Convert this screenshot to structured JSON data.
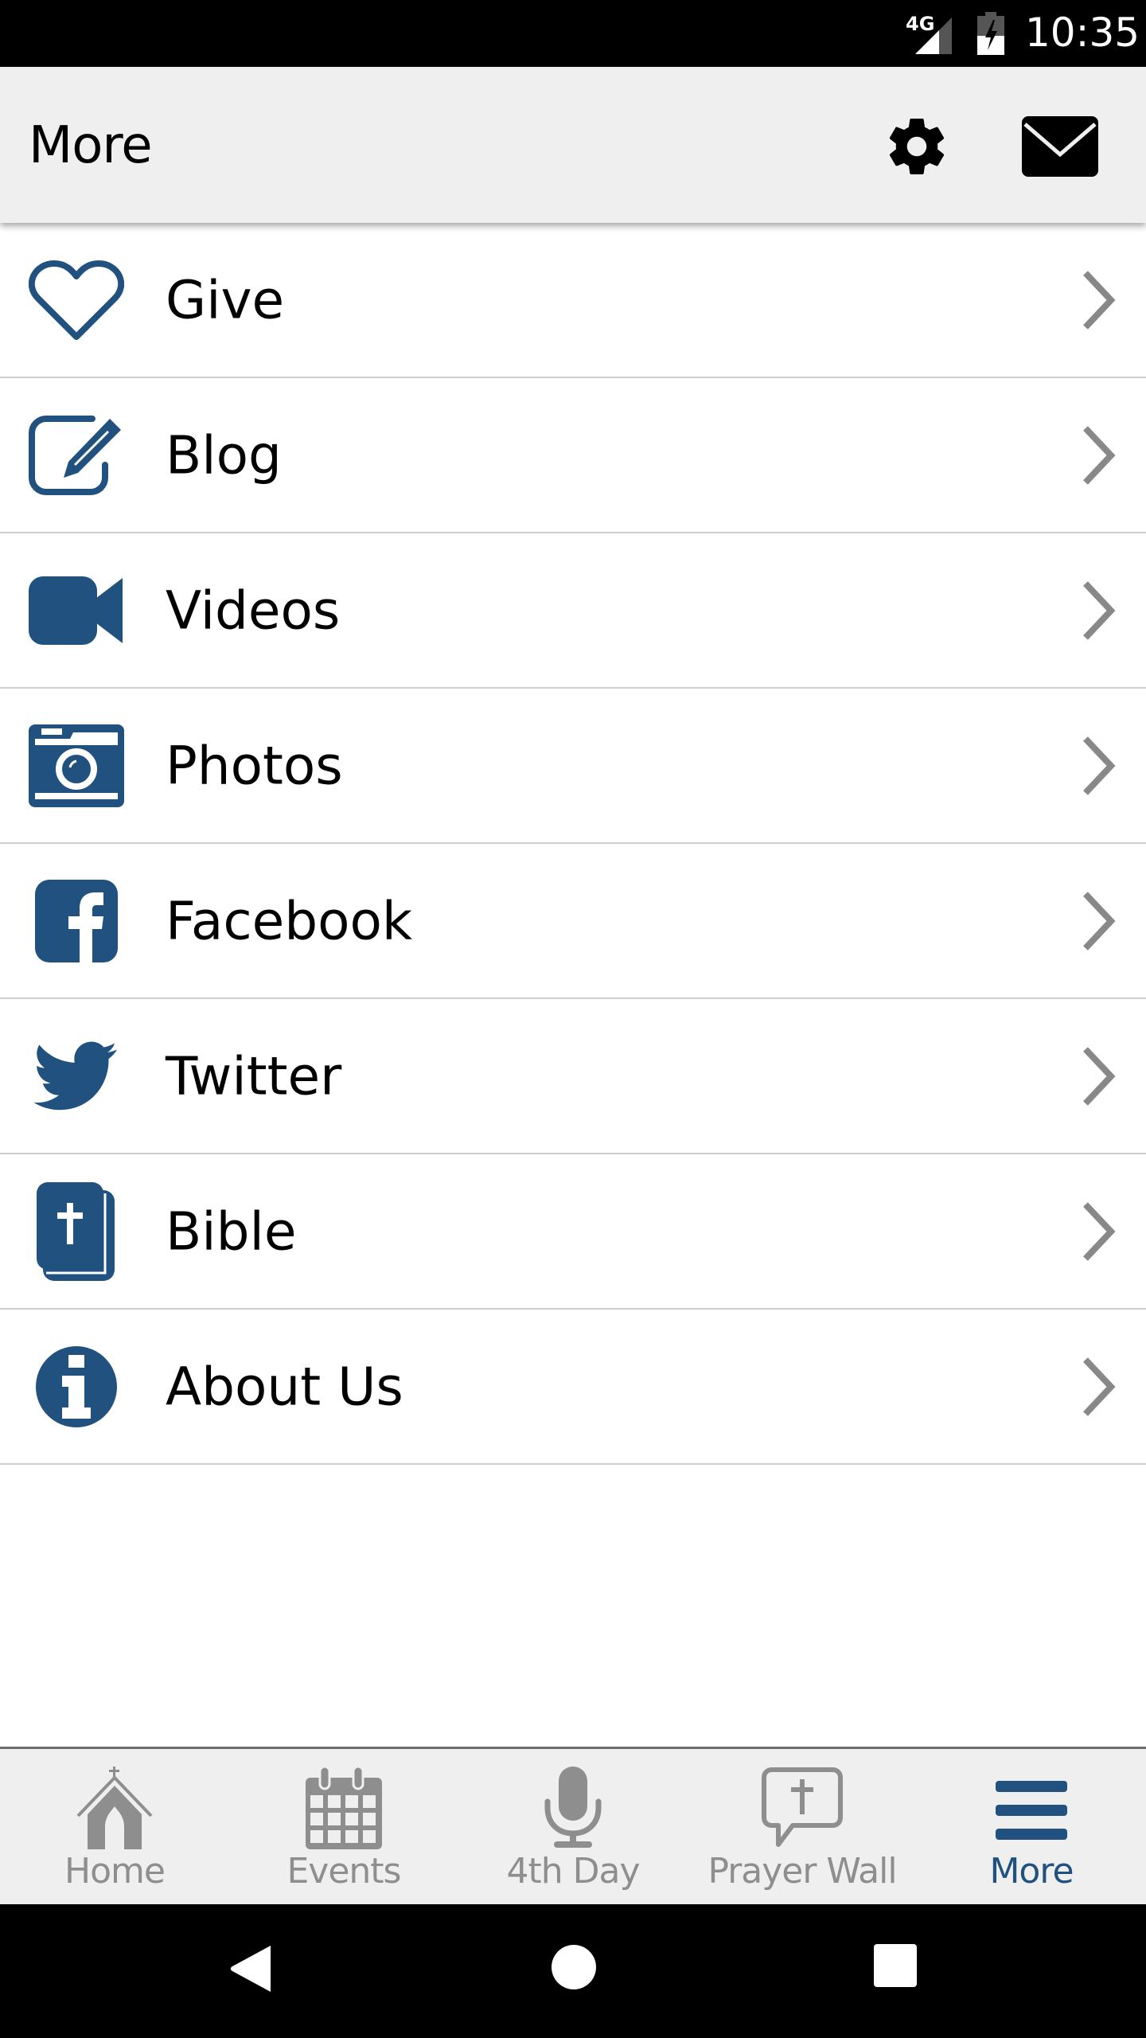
{
  "status_bar": {
    "network": "4G",
    "time": "10:35",
    "icons": [
      "signal-icon",
      "battery-charging-icon"
    ]
  },
  "header": {
    "title": "More",
    "actions": [
      {
        "name": "settings",
        "icon": "gear-icon"
      },
      {
        "name": "messages",
        "icon": "mail-icon"
      }
    ]
  },
  "menu": {
    "items": [
      {
        "label": "Give",
        "icon": "heart-icon"
      },
      {
        "label": "Blog",
        "icon": "edit-icon"
      },
      {
        "label": "Videos",
        "icon": "video-camera-icon"
      },
      {
        "label": "Photos",
        "icon": "camera-icon"
      },
      {
        "label": "Facebook",
        "icon": "facebook-icon"
      },
      {
        "label": "Twitter",
        "icon": "twitter-icon"
      },
      {
        "label": "Bible",
        "icon": "bible-icon"
      },
      {
        "label": "About Us",
        "icon": "info-icon"
      }
    ]
  },
  "tab_bar": {
    "tabs": [
      {
        "label": "Home",
        "icon": "church-icon",
        "active": false
      },
      {
        "label": "Events",
        "icon": "calendar-icon",
        "active": false
      },
      {
        "label": "4th Day",
        "icon": "microphone-icon",
        "active": false
      },
      {
        "label": "Prayer Wall",
        "icon": "prayer-bubble-icon",
        "active": false
      },
      {
        "label": "More",
        "icon": "menu-icon",
        "active": true
      }
    ]
  },
  "colors": {
    "brand": "#21527f",
    "inactive": "#8e8e8e",
    "header_bg": "#efefef",
    "divider": "#cfcfcf"
  }
}
